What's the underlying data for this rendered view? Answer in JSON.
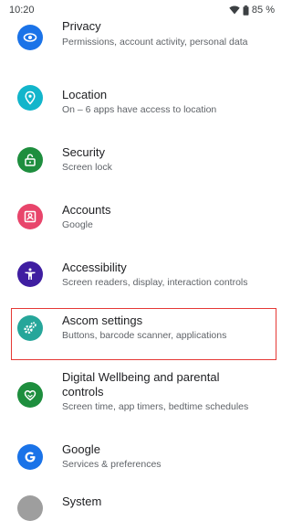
{
  "status_bar": {
    "time": "10:20",
    "battery": "85 %"
  },
  "settings_items": [
    {
      "title": "Privacy",
      "subtitle": "Permissions, account activity, personal data",
      "icon": "privacy-eye-icon",
      "color": "#1a73e8"
    },
    {
      "title": "Location",
      "subtitle": "On – 6 apps have access to location",
      "icon": "location-pin-icon",
      "color": "#12b5cb"
    },
    {
      "title": "Security",
      "subtitle": "Screen lock",
      "icon": "lock-open-icon",
      "color": "#1e8e3e"
    },
    {
      "title": "Accounts",
      "subtitle": "Google",
      "icon": "account-box-icon",
      "color": "#e8456b"
    },
    {
      "title": "Accessibility",
      "subtitle": "Screen readers, display, interaction controls",
      "icon": "accessibility-person-icon",
      "color": "#3f1ea1"
    },
    {
      "title": "Ascom settings",
      "subtitle": "Buttons, barcode scanner, applications",
      "icon": "gears-icon",
      "color": "#26a69a"
    },
    {
      "title": "Digital Wellbeing and parental controls",
      "subtitle": "Screen time, app timers, bedtime schedules",
      "icon": "wellbeing-heart-icon",
      "color": "#1e8e3e"
    },
    {
      "title": "Google",
      "subtitle": "Services & preferences",
      "icon": "google-g-icon",
      "color": "#1a73e8"
    },
    {
      "title": "System",
      "subtitle": "",
      "icon": "system-info-icon",
      "color": "#9e9e9e"
    }
  ],
  "highlight_color": "#e53935"
}
